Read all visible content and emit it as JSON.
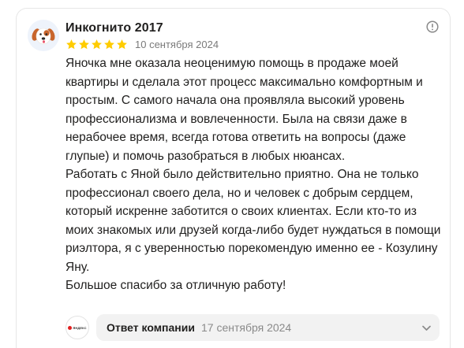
{
  "review": {
    "author": "Инкогнито 2017",
    "rating": 5,
    "rating_max": 5,
    "date": "10 сентября 2024",
    "paragraphs": [
      "Яночка мне оказала неоценимую помощь в продаже моей квартиры и сделала этот процесс максимально комфортным и простым. С самого начала она проявляла высокий уровень профессионализма и вовлеченности. Была на связи даже в нерабочее время, всегда готова ответить на вопросы (даже глупые) и помочь разобраться в любых нюансах.",
      "Работать с Яной было действительно приятно. Она не только профессионал своего дела, но и человек с добрым сердцем, который искренне заботится о своих клиентах. Если кто-то из моих знакомых или друзей когда-либо будет нуждаться в помощи риэлтора, я с уверенностью порекомендую именно ее - Козулину Яну.",
      "Большое спасибо за отличную работу!"
    ]
  },
  "company_reply": {
    "label": "Ответ компании",
    "date": "17 сентября 2024",
    "logo_text": "ЯНДЕКС"
  },
  "icons": {
    "avatar": "dog-avatar-icon",
    "info": "info-icon",
    "star": "star-icon",
    "expand": "chevron-down-icon"
  },
  "colors": {
    "star": "#fc0",
    "reply_bg": "#f2f2f2",
    "muted_text": "#7a7a7a"
  }
}
